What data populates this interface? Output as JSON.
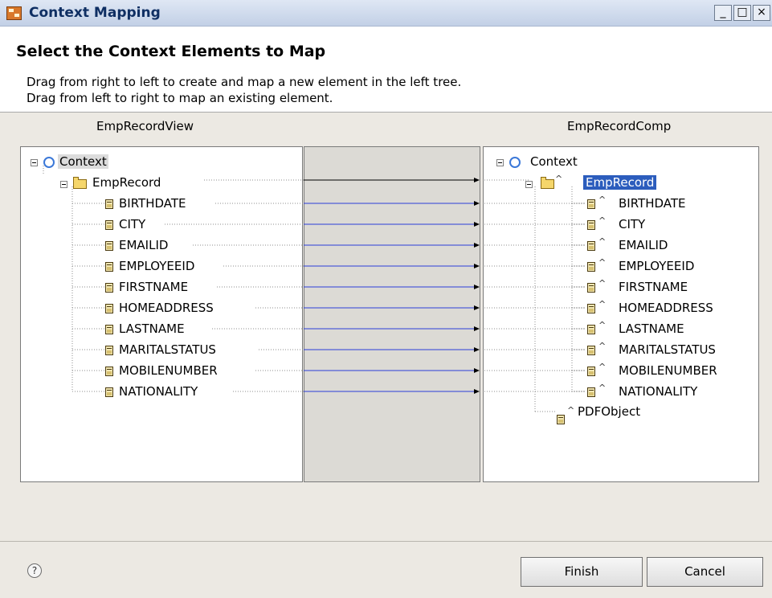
{
  "window": {
    "title": "Context Mapping",
    "controls": {
      "minimize": "_",
      "maximize": "□",
      "close": "×"
    }
  },
  "header": {
    "title": "Select the Context Elements to Map",
    "description_line1": "Drag from right to left to create and map a new element in the left tree.",
    "description_line2": "Drag from left to right to map an existing element."
  },
  "left_tree": {
    "title": "EmpRecordView",
    "root": {
      "label": "Context",
      "icon": "context-node-icon"
    },
    "node": {
      "label": "EmpRecord",
      "icon": "folder-icon"
    },
    "attributes": [
      "BIRTHDATE",
      "CITY",
      "EMAILID",
      "EMPLOYEEID",
      "FIRSTNAME",
      "HOMEADDRESS",
      "LASTNAME",
      "MARITALSTATUS",
      "MOBILENUMBER",
      "NATIONALITY"
    ]
  },
  "right_tree": {
    "title": "EmpRecordComp",
    "root": {
      "label": "Context",
      "icon": "context-node-icon"
    },
    "node": {
      "label": "EmpRecord",
      "icon": "folder-icon",
      "selected": true
    },
    "attributes": [
      "BIRTHDATE",
      "CITY",
      "EMAILID",
      "EMPLOYEEID",
      "FIRSTNAME",
      "HOMEADDRESS",
      "LASTNAME",
      "MARITALSTATUS",
      "MOBILENUMBER",
      "NATIONALITY"
    ],
    "extra_attribute": "PDFObject"
  },
  "mapping": {
    "line_color": "#2b3fd9"
  },
  "footer": {
    "help_icon": "?",
    "finish_label": "Finish",
    "cancel_label": "Cancel"
  },
  "colors": {
    "selection_blue": "#2c5dbd",
    "title_text": "#0f2f63"
  }
}
